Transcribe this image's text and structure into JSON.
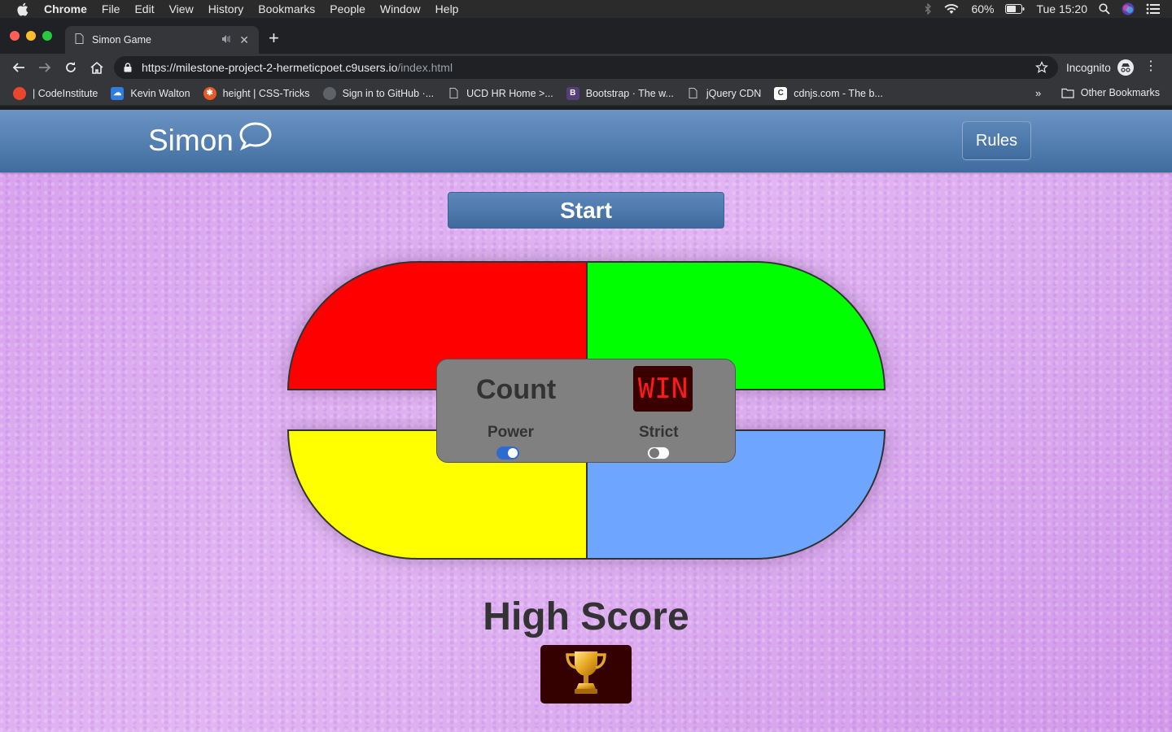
{
  "menubar": {
    "app": "Chrome",
    "items": [
      "File",
      "Edit",
      "View",
      "History",
      "Bookmarks",
      "People",
      "Window",
      "Help"
    ],
    "battery": "60%",
    "clock": "Tue 15:20"
  },
  "browser": {
    "tab_title": "Simon Game",
    "url_host": "https://milestone-project-2-hermeticpoet.c9users.io",
    "url_path": "/index.html",
    "incognito_label": "Incognito",
    "bookmarks": [
      {
        "label": "| CodeInstitute",
        "icon": "code-institute-icon",
        "color": "#e8472c"
      },
      {
        "label": "Kevin Walton",
        "icon": "cloud-icon",
        "color": "#2f7de1"
      },
      {
        "label": "height | CSS-Tricks",
        "icon": "css-tricks-icon",
        "color": "#e85a25"
      },
      {
        "label": "Sign in to GitHub ·...",
        "icon": "github-icon",
        "color": "#202124"
      },
      {
        "label": "UCD HR Home >...",
        "icon": "page-icon",
        "color": "#35363a"
      },
      {
        "label": "Bootstrap · The w...",
        "icon": "bootstrap-icon",
        "color": "#563d7c"
      },
      {
        "label": "jQuery CDN",
        "icon": "page-icon",
        "color": "#35363a"
      },
      {
        "label": "cdnjs.com - The b...",
        "icon": "cdnjs-icon",
        "color": "#ffffff"
      }
    ],
    "more_bookmarks": "»",
    "other_bookmarks": "Other Bookmarks"
  },
  "page": {
    "brand": "Simon",
    "rules_label": "Rules",
    "start_label": "Start",
    "quadrants": {
      "top_left": "#ff0000",
      "top_right": "#00ff00",
      "bottom_left": "#ffff00",
      "bottom_right": "#6ea5ff"
    },
    "console": {
      "count_label": "Count",
      "display_value": "WIN",
      "power_label": "Power",
      "power_on": true,
      "strict_label": "Strict",
      "strict_on": false
    },
    "high_score_title": "High Score",
    "high_score_icon": "trophy-icon"
  }
}
